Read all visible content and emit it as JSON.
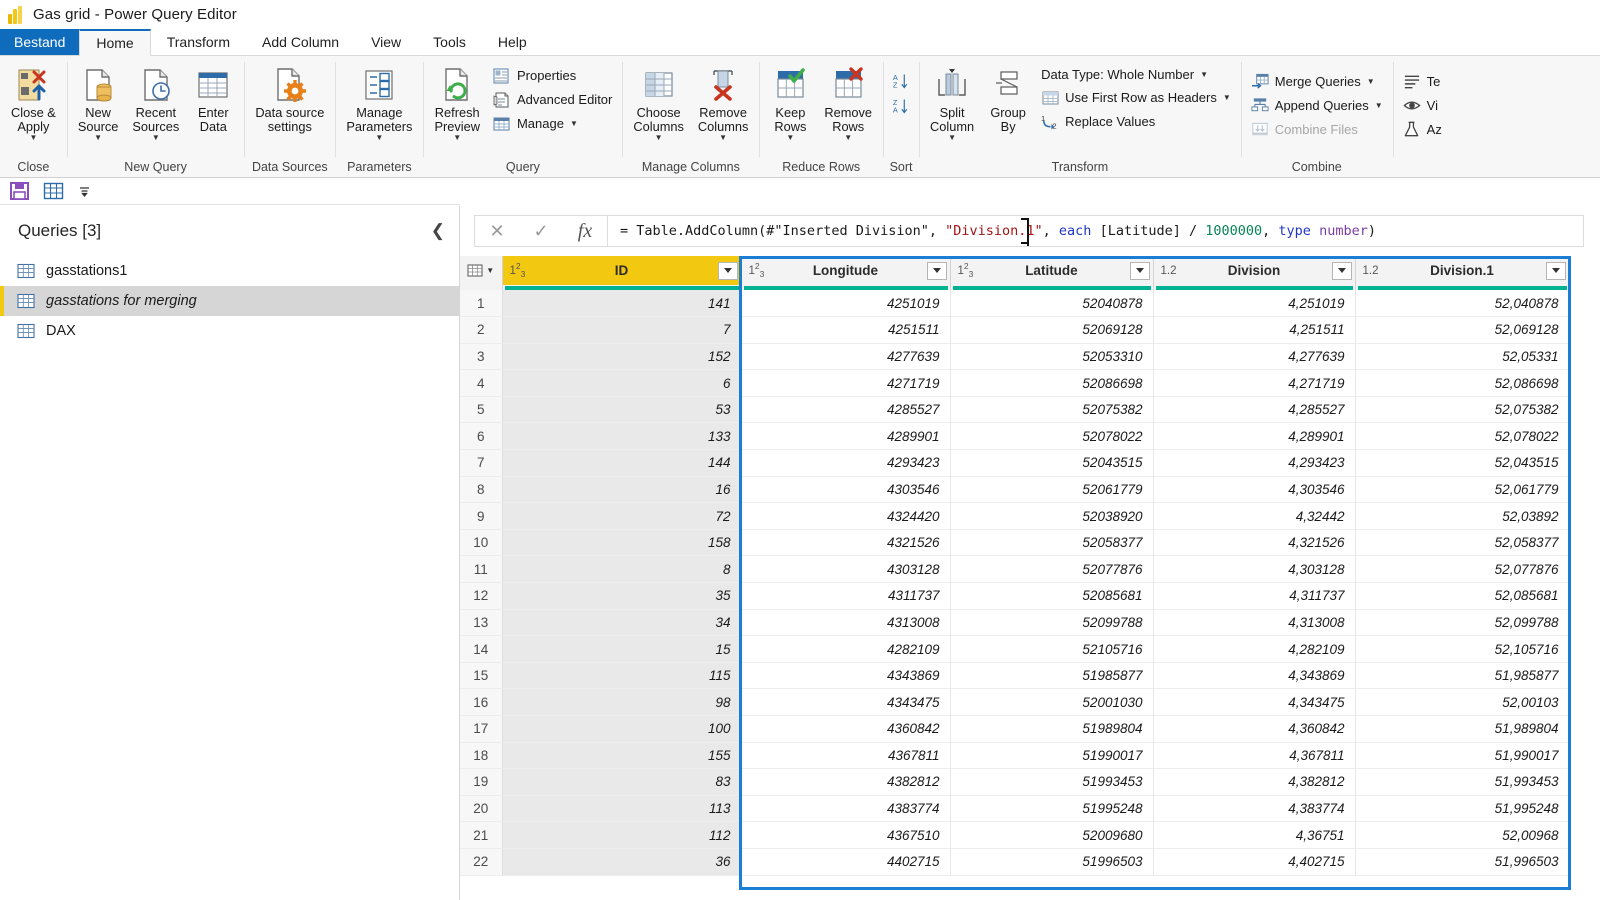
{
  "window": {
    "title": "Gas grid - Power Query Editor",
    "logo_icon": "power-bi-logo"
  },
  "tabs": [
    {
      "id": "file",
      "label": "Bestand",
      "state": "file"
    },
    {
      "id": "home",
      "label": "Home",
      "state": "active"
    },
    {
      "id": "transform",
      "label": "Transform",
      "state": "normal"
    },
    {
      "id": "addcolumn",
      "label": "Add Column",
      "state": "normal"
    },
    {
      "id": "view",
      "label": "View",
      "state": "normal"
    },
    {
      "id": "tools",
      "label": "Tools",
      "state": "normal"
    },
    {
      "id": "help",
      "label": "Help",
      "state": "normal"
    }
  ],
  "ribbon": {
    "groups": [
      {
        "id": "close",
        "label": "Close",
        "buttons": [
          {
            "id": "close-apply",
            "label": "Close &\nApply",
            "icon": "close-apply-icon",
            "caret": true
          }
        ]
      },
      {
        "id": "new-query",
        "label": "New Query",
        "buttons": [
          {
            "id": "new-source",
            "label": "New\nSource",
            "icon": "new-source-icon",
            "caret": true
          },
          {
            "id": "recent-sources",
            "label": "Recent\nSources",
            "icon": "recent-sources-icon",
            "caret": true
          },
          {
            "id": "enter-data",
            "label": "Enter\nData",
            "icon": "enter-data-icon",
            "caret": false
          }
        ]
      },
      {
        "id": "data-sources",
        "label": "Data Sources",
        "buttons": [
          {
            "id": "data-source-settings",
            "label": "Data source\nsettings",
            "icon": "data-source-settings-icon",
            "caret": false
          }
        ]
      },
      {
        "id": "parameters",
        "label": "Parameters",
        "buttons": [
          {
            "id": "manage-parameters",
            "label": "Manage\nParameters",
            "icon": "manage-parameters-icon",
            "caret": true
          }
        ]
      },
      {
        "id": "query",
        "label": "Query",
        "buttons": [
          {
            "id": "refresh-preview",
            "label": "Refresh\nPreview",
            "icon": "refresh-preview-icon",
            "caret": true
          }
        ],
        "small": [
          {
            "id": "properties",
            "label": "Properties",
            "icon": "properties-icon",
            "caret": false,
            "disabled": false
          },
          {
            "id": "advanced-editor",
            "label": "Advanced Editor",
            "icon": "advanced-editor-icon",
            "caret": false,
            "disabled": false
          },
          {
            "id": "manage",
            "label": "Manage",
            "icon": "manage-icon",
            "caret": true,
            "disabled": false
          }
        ]
      },
      {
        "id": "manage-columns",
        "label": "Manage Columns",
        "buttons": [
          {
            "id": "choose-columns",
            "label": "Choose\nColumns",
            "icon": "choose-columns-icon",
            "caret": true
          },
          {
            "id": "remove-columns",
            "label": "Remove\nColumns",
            "icon": "remove-columns-icon",
            "caret": true
          }
        ]
      },
      {
        "id": "reduce-rows",
        "label": "Reduce Rows",
        "buttons": [
          {
            "id": "keep-rows",
            "label": "Keep\nRows",
            "icon": "keep-rows-icon",
            "caret": true
          },
          {
            "id": "remove-rows",
            "label": "Remove\nRows",
            "icon": "remove-rows-icon",
            "caret": true
          }
        ]
      },
      {
        "id": "sort",
        "label": "Sort",
        "sort_buttons": [
          {
            "id": "sort-ascending",
            "label": "AZ",
            "icon": "sort-ascending-icon"
          },
          {
            "id": "sort-descending",
            "label": "ZA",
            "icon": "sort-descending-icon"
          }
        ]
      },
      {
        "id": "transform",
        "label": "Transform",
        "buttons": [
          {
            "id": "split-column",
            "label": "Split\nColumn",
            "icon": "split-column-icon",
            "caret": true
          },
          {
            "id": "group-by",
            "label": "Group\nBy",
            "icon": "group-by-icon",
            "caret": false
          }
        ],
        "small": [
          {
            "id": "data-type",
            "label": "Data Type: Whole Number",
            "icon": "none",
            "caret": true,
            "disabled": false
          },
          {
            "id": "use-first-row-headers",
            "label": "Use First Row as Headers",
            "icon": "first-row-headers-icon",
            "caret": true,
            "disabled": false
          },
          {
            "id": "replace-values",
            "label": "Replace Values",
            "icon": "replace-values-icon",
            "caret": false,
            "disabled": false
          }
        ]
      },
      {
        "id": "combine",
        "label": "Combine",
        "small": [
          {
            "id": "merge-queries",
            "label": "Merge Queries",
            "icon": "merge-queries-icon",
            "caret": true,
            "disabled": false
          },
          {
            "id": "append-queries",
            "label": "Append Queries",
            "icon": "append-queries-icon",
            "caret": true,
            "disabled": false
          },
          {
            "id": "combine-files",
            "label": "Combine Files",
            "icon": "combine-files-icon",
            "caret": false,
            "disabled": true
          }
        ]
      },
      {
        "id": "ai-insights",
        "label": "",
        "small": [
          {
            "id": "text-analytics",
            "label": "Te",
            "icon": "text-analytics-icon",
            "caret": false,
            "disabled": false
          },
          {
            "id": "vision",
            "label": "Vi",
            "icon": "vision-icon",
            "caret": false,
            "disabled": false
          },
          {
            "id": "azure-ml",
            "label": "Az",
            "icon": "azure-ml-icon",
            "caret": false,
            "disabled": false
          }
        ]
      }
    ]
  },
  "quick_access": [
    {
      "id": "save",
      "icon": "save-icon"
    },
    {
      "id": "grid-view",
      "icon": "grid-icon"
    },
    {
      "id": "customize-qat",
      "icon": "chevron-down-icon"
    }
  ],
  "queries_pane": {
    "title": "Queries [3]",
    "collapse_icon": "chevron-left-icon",
    "items": [
      {
        "id": "gasstations1",
        "label": "gasstations1",
        "icon": "table-icon",
        "selected": false
      },
      {
        "id": "gasstations-for-merging",
        "label": "gasstations for merging",
        "icon": "table-icon",
        "selected": true
      },
      {
        "id": "dax",
        "label": "DAX",
        "icon": "table-icon",
        "selected": false
      }
    ]
  },
  "formula_bar": {
    "cancel_icon": "cancel-icon",
    "accept_icon": "checkmark-icon",
    "fx_icon": "fx-icon",
    "value": "= Table.AddColumn(#\"Inserted Division\", \"Division.1\", each [Latitude] / 1000000, type number)",
    "tokens": [
      {
        "text": "= Table.AddColumn(#\"Inserted Division\", ",
        "kind": "plain"
      },
      {
        "text": "\"Division.1\"",
        "kind": "string"
      },
      {
        "text": ", ",
        "kind": "plain"
      },
      {
        "text": "each",
        "kind": "keyword"
      },
      {
        "text": " [Latitude] / ",
        "kind": "plain"
      },
      {
        "text": "1000000",
        "kind": "number"
      },
      {
        "text": ", ",
        "kind": "plain"
      },
      {
        "text": "type",
        "kind": "keyword"
      },
      {
        "text": " ",
        "kind": "plain"
      },
      {
        "text": "number",
        "kind": "type"
      },
      {
        "text": ")",
        "kind": "plain"
      }
    ]
  },
  "grid": {
    "select_all_icon": "select-all-icon",
    "filter_icon": "filter-dropdown-icon",
    "quality_bar_color": "#00B294",
    "id_header_color": "#F2C811",
    "selection_border_color": "#1A7FD4",
    "columns": [
      {
        "id": "id",
        "name": "ID",
        "type_glyph": "123",
        "highlighted": true,
        "selected": false
      },
      {
        "id": "longitude",
        "name": "Longitude",
        "type_glyph": "123",
        "highlighted": false,
        "selected": true
      },
      {
        "id": "latitude",
        "name": "Latitude",
        "type_glyph": "123",
        "highlighted": false,
        "selected": true
      },
      {
        "id": "division",
        "name": "Division",
        "type_glyph": "1.2",
        "highlighted": false,
        "selected": true
      },
      {
        "id": "division1",
        "name": "Division.1",
        "type_glyph": "1.2",
        "highlighted": false,
        "selected": true
      }
    ],
    "rows": [
      {
        "n": "1",
        "id": "141",
        "longitude": "4251019",
        "latitude": "52040878",
        "division": "4,251019",
        "division1": "52,040878"
      },
      {
        "n": "2",
        "id": "7",
        "longitude": "4251511",
        "latitude": "52069128",
        "division": "4,251511",
        "division1": "52,069128"
      },
      {
        "n": "3",
        "id": "152",
        "longitude": "4277639",
        "latitude": "52053310",
        "division": "4,277639",
        "division1": "52,05331"
      },
      {
        "n": "4",
        "id": "6",
        "longitude": "4271719",
        "latitude": "52086698",
        "division": "4,271719",
        "division1": "52,086698"
      },
      {
        "n": "5",
        "id": "53",
        "longitude": "4285527",
        "latitude": "52075382",
        "division": "4,285527",
        "division1": "52,075382"
      },
      {
        "n": "6",
        "id": "133",
        "longitude": "4289901",
        "latitude": "52078022",
        "division": "4,289901",
        "division1": "52,078022"
      },
      {
        "n": "7",
        "id": "144",
        "longitude": "4293423",
        "latitude": "52043515",
        "division": "4,293423",
        "division1": "52,043515"
      },
      {
        "n": "8",
        "id": "16",
        "longitude": "4303546",
        "latitude": "52061779",
        "division": "4,303546",
        "division1": "52,061779"
      },
      {
        "n": "9",
        "id": "72",
        "longitude": "4324420",
        "latitude": "52038920",
        "division": "4,32442",
        "division1": "52,03892"
      },
      {
        "n": "10",
        "id": "158",
        "longitude": "4321526",
        "latitude": "52058377",
        "division": "4,321526",
        "division1": "52,058377"
      },
      {
        "n": "11",
        "id": "8",
        "longitude": "4303128",
        "latitude": "52077876",
        "division": "4,303128",
        "division1": "52,077876"
      },
      {
        "n": "12",
        "id": "35",
        "longitude": "4311737",
        "latitude": "52085681",
        "division": "4,311737",
        "division1": "52,085681"
      },
      {
        "n": "13",
        "id": "34",
        "longitude": "4313008",
        "latitude": "52099788",
        "division": "4,313008",
        "division1": "52,099788"
      },
      {
        "n": "14",
        "id": "15",
        "longitude": "4282109",
        "latitude": "52105716",
        "division": "4,282109",
        "division1": "52,105716"
      },
      {
        "n": "15",
        "id": "115",
        "longitude": "4343869",
        "latitude": "51985877",
        "division": "4,343869",
        "division1": "51,985877"
      },
      {
        "n": "16",
        "id": "98",
        "longitude": "4343475",
        "latitude": "52001030",
        "division": "4,343475",
        "division1": "52,00103"
      },
      {
        "n": "17",
        "id": "100",
        "longitude": "4360842",
        "latitude": "51989804",
        "division": "4,360842",
        "division1": "51,989804"
      },
      {
        "n": "18",
        "id": "155",
        "longitude": "4367811",
        "latitude": "51990017",
        "division": "4,367811",
        "division1": "51,990017"
      },
      {
        "n": "19",
        "id": "83",
        "longitude": "4382812",
        "latitude": "51993453",
        "division": "4,382812",
        "division1": "51,993453"
      },
      {
        "n": "20",
        "id": "113",
        "longitude": "4383774",
        "latitude": "51995248",
        "division": "4,383774",
        "division1": "51,995248"
      },
      {
        "n": "21",
        "id": "112",
        "longitude": "4367510",
        "latitude": "52009680",
        "division": "4,36751",
        "division1": "52,00968"
      },
      {
        "n": "22",
        "id": "36",
        "longitude": "4402715",
        "latitude": "51996503",
        "division": "4,402715",
        "division1": "51,996503"
      }
    ]
  }
}
